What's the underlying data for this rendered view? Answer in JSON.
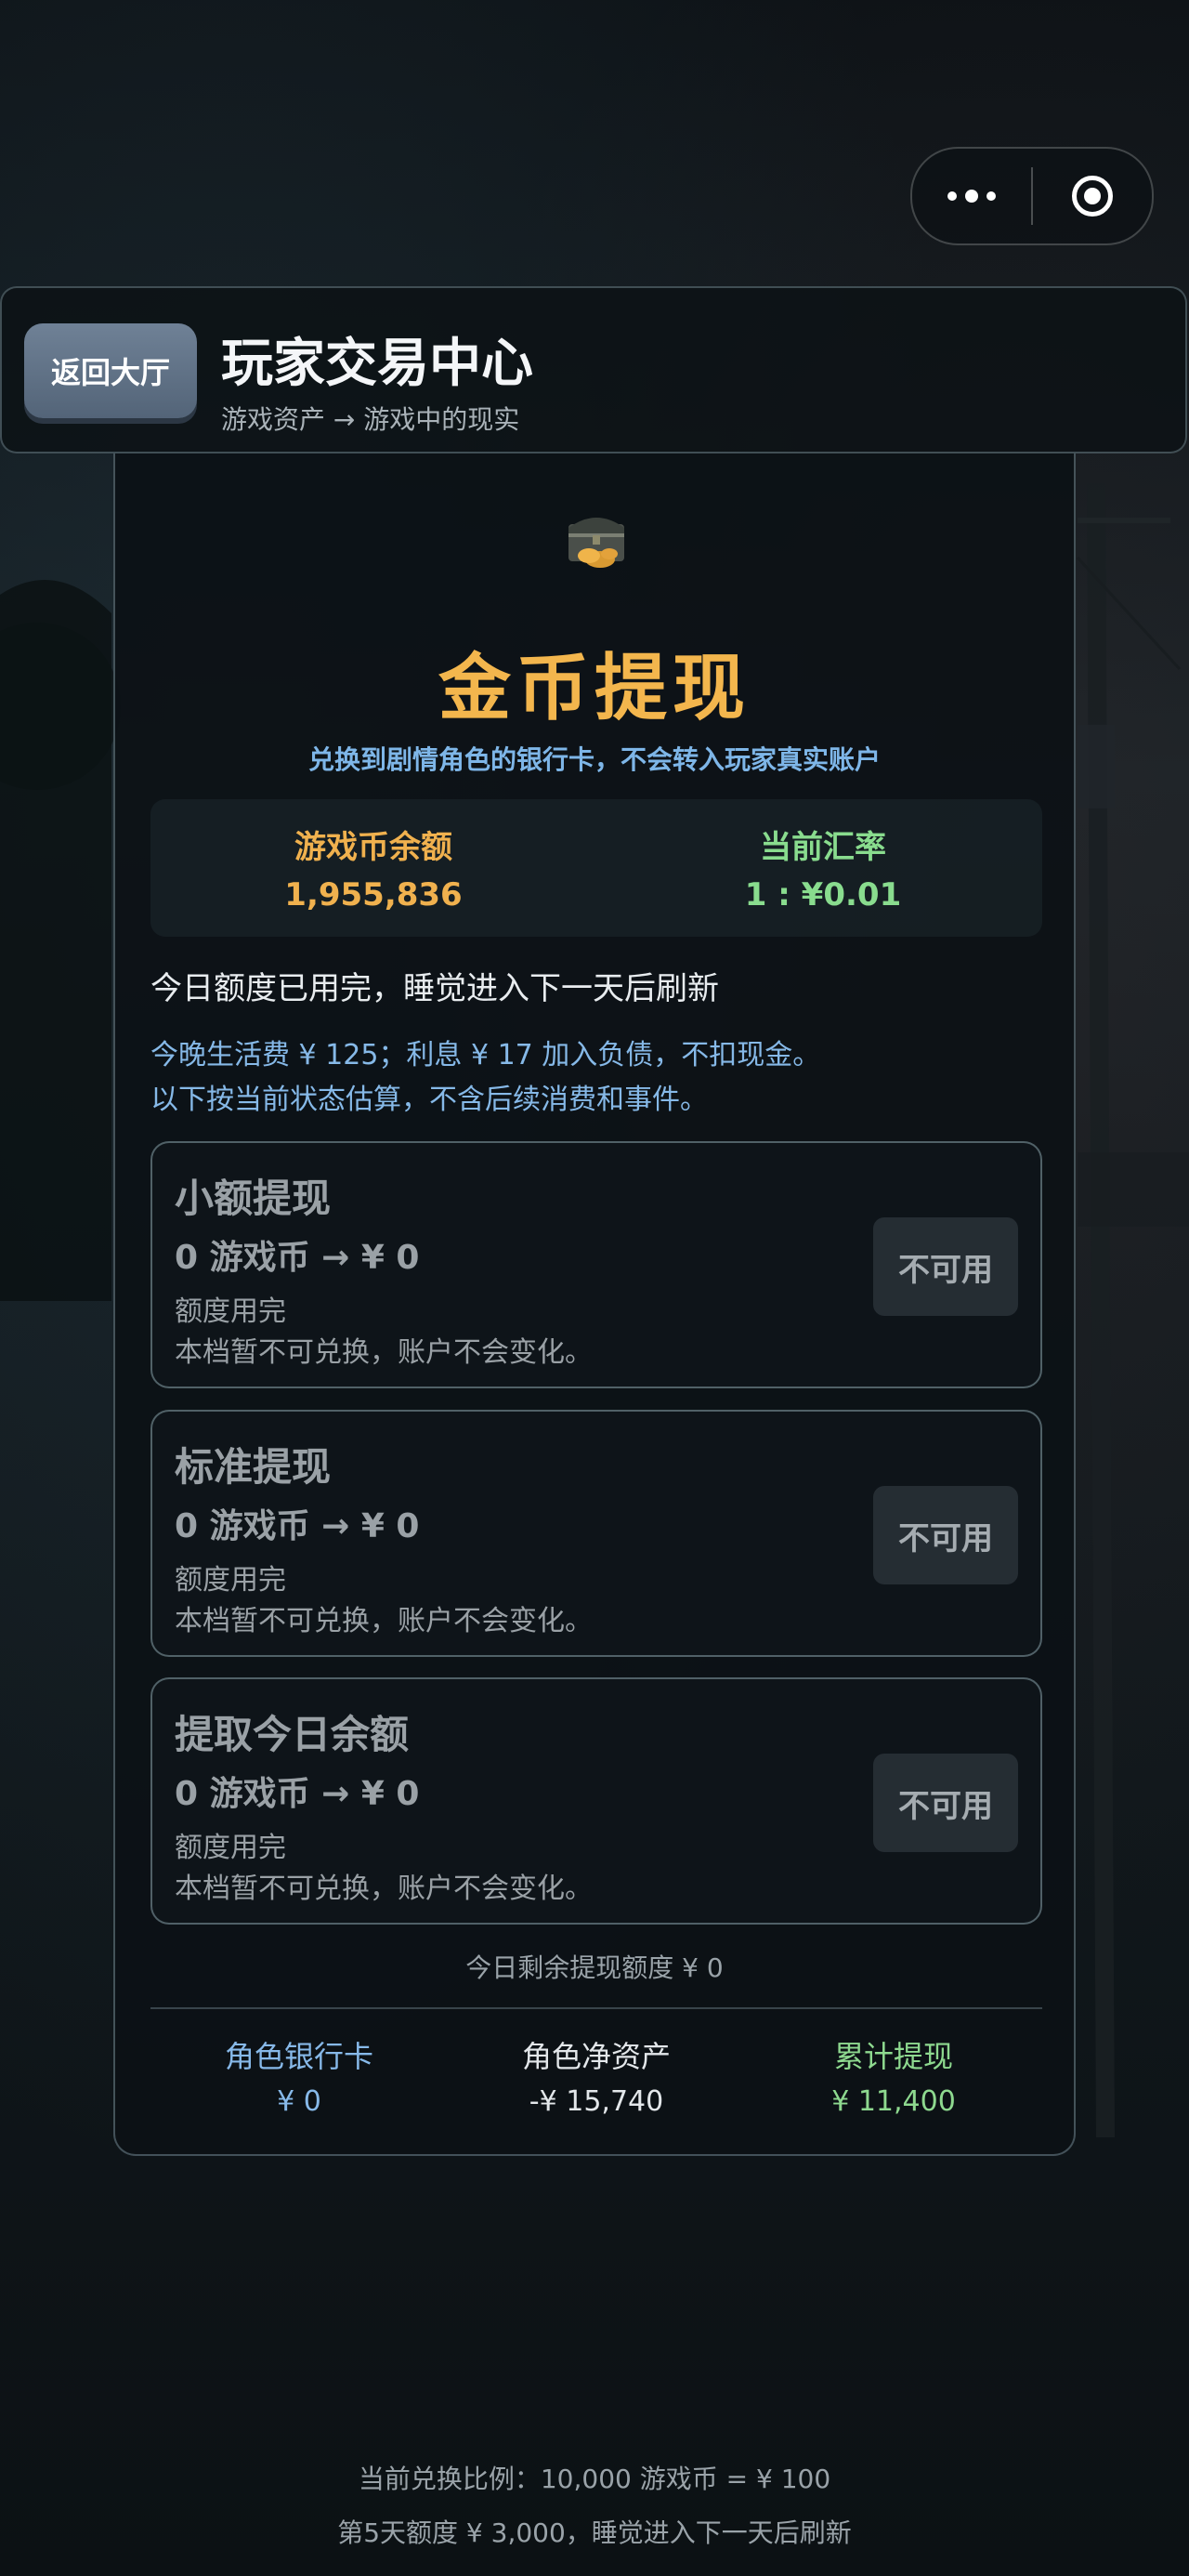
{
  "header": {
    "back_label": "返回大厅",
    "title": "玩家交易中心",
    "subtitle": "游戏资产 → 游戏中的现实"
  },
  "card": {
    "icon": "treasure-chest-icon",
    "title": "金币提现",
    "subtitle": "兑换到剧情角色的银行卡，不会转入玩家真实账户",
    "balance_label": "游戏币余额",
    "balance_value": "1,955,836",
    "rate_label": "当前汇率",
    "rate_value": "1 : ¥0.01",
    "notice": "今日额度已用完，睡觉进入下一天后刷新",
    "info_line1": "今晚生活费 ¥ 125；利息 ¥ 17 加入负债，不扣现金。",
    "info_line2": "以下按当前状态估算，不含后续消费和事件。",
    "options": [
      {
        "name": "小额提现",
        "conversion": "0 游戏币 → ¥ 0",
        "status": "额度用完",
        "description": "本档暂不可兑换，账户不会变化。",
        "button": "不可用"
      },
      {
        "name": "标准提现",
        "conversion": "0 游戏币 → ¥ 0",
        "status": "额度用完",
        "description": "本档暂不可兑换，账户不会变化。",
        "button": "不可用"
      },
      {
        "name": "提取今日余额",
        "conversion": "0 游戏币 → ¥ 0",
        "status": "额度用完",
        "description": "本档暂不可兑换，账户不会变化。",
        "button": "不可用"
      }
    ],
    "remaining": "今日剩余提现额度 ¥ 0",
    "summary": {
      "bank_label": "角色银行卡",
      "bank_value": "¥ 0",
      "net_label": "角色净资产",
      "net_value": "-¥ 15,740",
      "total_label": "累计提现",
      "total_value": "¥ 11,400"
    }
  },
  "footer": {
    "ratio": "当前兑换比例：10,000 游戏币 = ¥ 100",
    "quota": "第5天额度 ¥ 3,000，睡觉进入下一天后刷新"
  },
  "colors": {
    "gold": "#f0b14e",
    "blue": "#86b9e8",
    "green": "#89dc8e"
  }
}
